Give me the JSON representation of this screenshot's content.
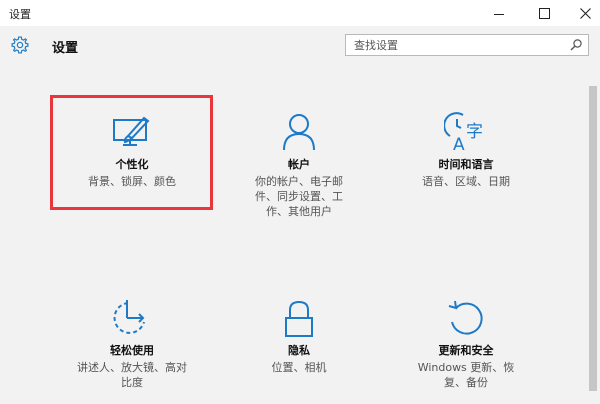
{
  "window": {
    "title": "设置"
  },
  "header": {
    "title": "设置"
  },
  "search": {
    "placeholder": "查找设置"
  },
  "tiles": [
    {
      "name": "个性化",
      "desc": "背景、锁屏、颜色",
      "icon": "personalization-icon"
    },
    {
      "name": "帐户",
      "desc": "你的帐户、电子邮件、同步设置、工作、其他用户",
      "icon": "account-icon"
    },
    {
      "name": "时间和语言",
      "desc": "语音、区域、日期",
      "icon": "time-language-icon"
    },
    {
      "name": "轻松使用",
      "desc": "讲述人、放大镜、高对比度",
      "icon": "ease-of-access-icon"
    },
    {
      "name": "隐私",
      "desc": "位置、相机",
      "icon": "privacy-lock-icon"
    },
    {
      "name": "更新和安全",
      "desc": "Windows 更新、恢复、备份",
      "icon": "update-security-icon"
    }
  ],
  "colors": {
    "accent": "#1e7ac6",
    "highlight": "#e8363c",
    "background": "#f2f2f2"
  }
}
